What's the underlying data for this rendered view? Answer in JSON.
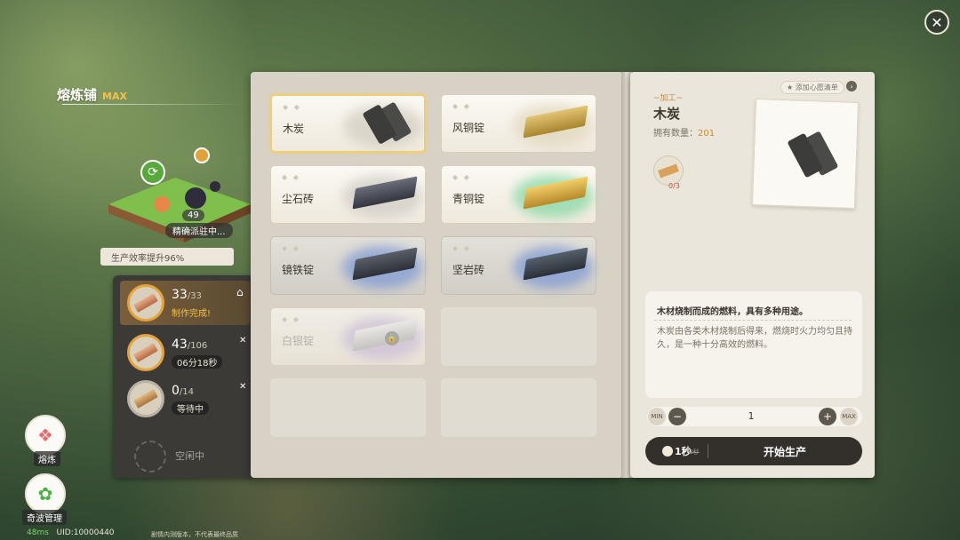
{
  "shop": {
    "name": "熔炼铺",
    "level": "MAX",
    "level_number": "49",
    "status": "精确派驻中...",
    "efficiency": "生产效率提升96%"
  },
  "queue": {
    "items": [
      {
        "count": "33",
        "total": "/33",
        "status": "制作完成!"
      },
      {
        "count": "43",
        "total": "/106",
        "time": "06分18秒"
      },
      {
        "count": "0",
        "total": "/14",
        "time": "等待中"
      }
    ],
    "idle": "空闲中"
  },
  "side_nav": {
    "smelt": "熔炼",
    "creature": "奇波管理"
  },
  "footer": {
    "ping": "48ms",
    "uid": "UID:10000440",
    "note": "剧情内测版本，不代表最终品质"
  },
  "recipes": [
    {
      "label": "木炭"
    },
    {
      "label": "风铜锭"
    },
    {
      "label": "尘石砖"
    },
    {
      "label": "青铜锭"
    },
    {
      "label": "镜铁锭"
    },
    {
      "label": "坚岩砖"
    },
    {
      "label": "白银锭"
    }
  ],
  "detail": {
    "subtitle": "~加工~",
    "name": "木炭",
    "owned_label": "拥有数量：",
    "owned_value": "201",
    "wishlist": "添加心愿清单",
    "material_count": "0/3",
    "desc_title": "木材烧制而成的燃料，具有多种用途。",
    "desc_body": "木炭由各类木材烧制后得来，燃烧时火力均匀且持久，是一种十分高效的燃料。",
    "min_label": "MIN",
    "max_label": "MAX",
    "quantity": "1",
    "time": "1秒",
    "orig_time": "3秒",
    "start_label": "开始生产"
  },
  "colors": {
    "accent": "#f2c24a",
    "dark_button": "#33302c",
    "panel": "#ebe6db"
  },
  "icons": {
    "close": "close-icon",
    "refresh": "refresh-icon",
    "clock": "clock-icon",
    "lock": "lock-icon",
    "basket": "basket-icon"
  }
}
